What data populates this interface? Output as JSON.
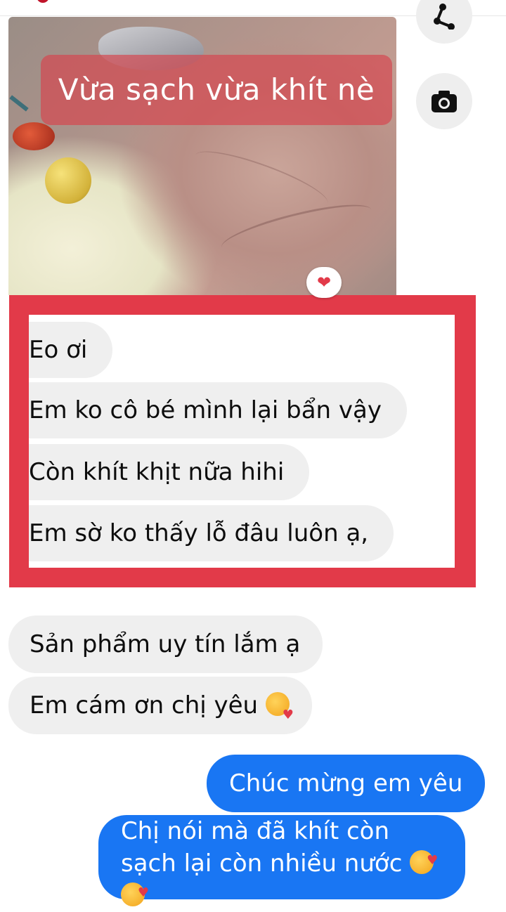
{
  "photo": {
    "caption": "Vừa sạch vừa khít nè"
  },
  "side_buttons": {
    "share_icon": "share-icon",
    "camera_icon": "camera-icon"
  },
  "highlighted_messages": [
    {
      "text": "Eo ơi"
    },
    {
      "text": "Em ko cô bé mình lại bẩn vậy"
    },
    {
      "text": "Còn khít khịt nữa hihi"
    },
    {
      "text": "Em sờ ko thấy lỗ đâu luôn ạ,"
    }
  ],
  "reaction_icon": "heart-reaction-icon",
  "incoming_messages": [
    {
      "text": "Sản phẩm uy tín lắm ạ"
    },
    {
      "text": "Em cám ơn chị yêu"
    }
  ],
  "outgoing_messages": [
    {
      "text": "Chúc mừng em yêu"
    },
    {
      "text": "Chị nói mà đã khít còn sạch lại còn nhiều nước"
    }
  ],
  "colors": {
    "highlight_frame": "#e23a49",
    "incoming_bubble": "#efefef",
    "outgoing_bubble": "#1976f3"
  }
}
